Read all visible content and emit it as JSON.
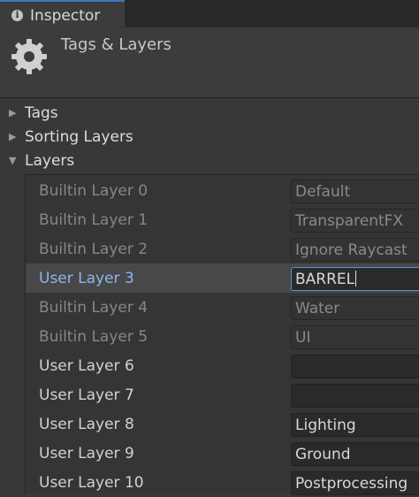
{
  "window": {
    "tab_title": "Inspector",
    "tab_icon": "info-icon"
  },
  "header": {
    "title": "Tags & Layers",
    "icon": "gear-icon"
  },
  "sections": {
    "tags": "Tags",
    "sorting_layers": "Sorting Layers",
    "layers": "Layers"
  },
  "layers": [
    {
      "name": "Builtin Layer 0",
      "value": "Default",
      "builtin": true
    },
    {
      "name": "Builtin Layer 1",
      "value": "TransparentFX",
      "builtin": true
    },
    {
      "name": "Builtin Layer 2",
      "value": "Ignore Raycast",
      "builtin": true
    },
    {
      "name": "User Layer 3",
      "value": "BARREL",
      "builtin": false,
      "selected": true
    },
    {
      "name": "Builtin Layer 4",
      "value": "Water",
      "builtin": true
    },
    {
      "name": "Builtin Layer 5",
      "value": "UI",
      "builtin": true
    },
    {
      "name": "User Layer 6",
      "value": "",
      "builtin": false
    },
    {
      "name": "User Layer 7",
      "value": "",
      "builtin": false
    },
    {
      "name": "User Layer 8",
      "value": "Lighting",
      "builtin": false
    },
    {
      "name": "User Layer 9",
      "value": "Ground",
      "builtin": false
    },
    {
      "name": "User Layer 10",
      "value": "Postprocessing",
      "builtin": false
    }
  ],
  "colors": {
    "tab_accent": "#3a79bb",
    "selected_label": "#8bb7f0",
    "selected_field_border": "#5b8fd0"
  }
}
